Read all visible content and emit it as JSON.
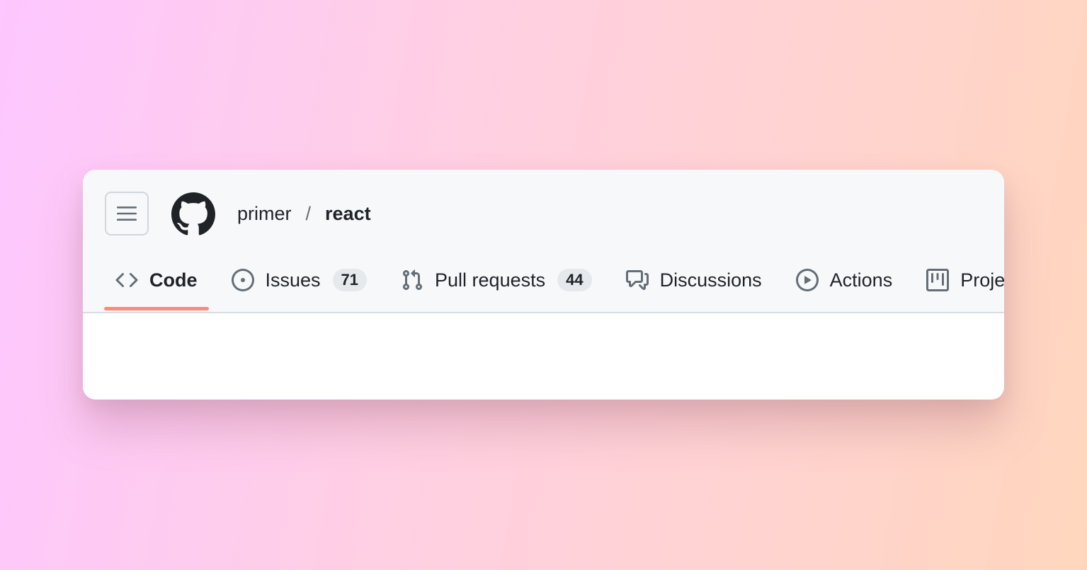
{
  "breadcrumb": {
    "owner": "primer",
    "separator": "/",
    "repo": "react"
  },
  "tabs": [
    {
      "label": "Code",
      "icon": "code-icon",
      "selected": true
    },
    {
      "label": "Issues",
      "icon": "issue-opened-icon",
      "counter": "71"
    },
    {
      "label": "Pull requests",
      "icon": "git-pull-request-icon",
      "counter": "44"
    },
    {
      "label": "Discussions",
      "icon": "comment-discussion-icon"
    },
    {
      "label": "Actions",
      "icon": "play-icon"
    },
    {
      "label": "Projects",
      "icon": "table-icon"
    }
  ],
  "colors": {
    "accent_underline": "#fd8c73",
    "header_bg": "#f6f8fa",
    "text": "#1f2328",
    "icon": "#656d76",
    "counter_bg": "#e6e9ec"
  }
}
